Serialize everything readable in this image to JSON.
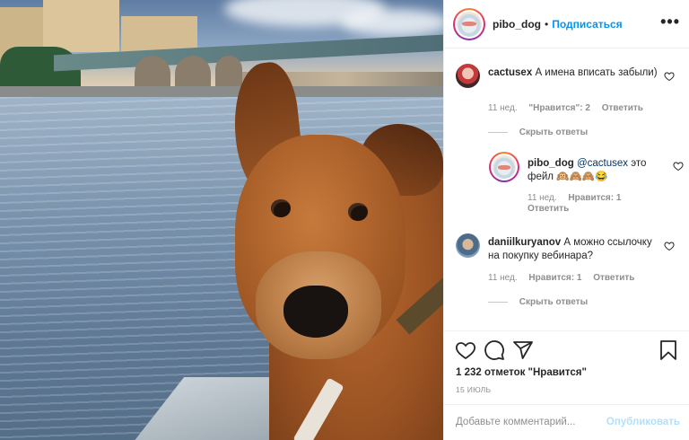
{
  "post": {
    "username": "pibo_dog",
    "separator": "•",
    "follow_label": "Подписаться",
    "more_icon": "more-horizontal-icon"
  },
  "comments": [
    {
      "username": "cactusex",
      "text": "А имена вписать забыли)",
      "time": "11 нед.",
      "likes": "\"Нравится\": 2",
      "reply_label": "Ответить",
      "hide_replies_label": "Скрыть ответы"
    },
    {
      "username": "pibo_dog",
      "mention": "@cactusex",
      "text": "это фейл 🙉🙈🙈😂",
      "time": "11 нед.",
      "likes": "Нравится: 1",
      "reply_label": "Ответить"
    },
    {
      "username": "daniilkuryanov",
      "text": "А можно ссылочку на покупку вебинара?",
      "time": "11 нед.",
      "likes": "Нравится: 1",
      "reply_label": "Ответить",
      "hide_replies_label": "Скрыть ответы"
    }
  ],
  "actions": {
    "like_icon": "heart-icon",
    "comment_icon": "comment-icon",
    "share_icon": "paper-plane-icon",
    "save_icon": "bookmark-icon",
    "likes_count": "1 232 отметок \"Нравится\"",
    "date": "15 ИЮЛЬ"
  },
  "add_comment": {
    "placeholder": "Добавьте комментарий...",
    "publish_label": "Опубликовать"
  },
  "colors": {
    "accent": "#0095f6",
    "publish_disabled": "#b2dffc",
    "muted": "#8e8e8e",
    "text": "#262626"
  }
}
